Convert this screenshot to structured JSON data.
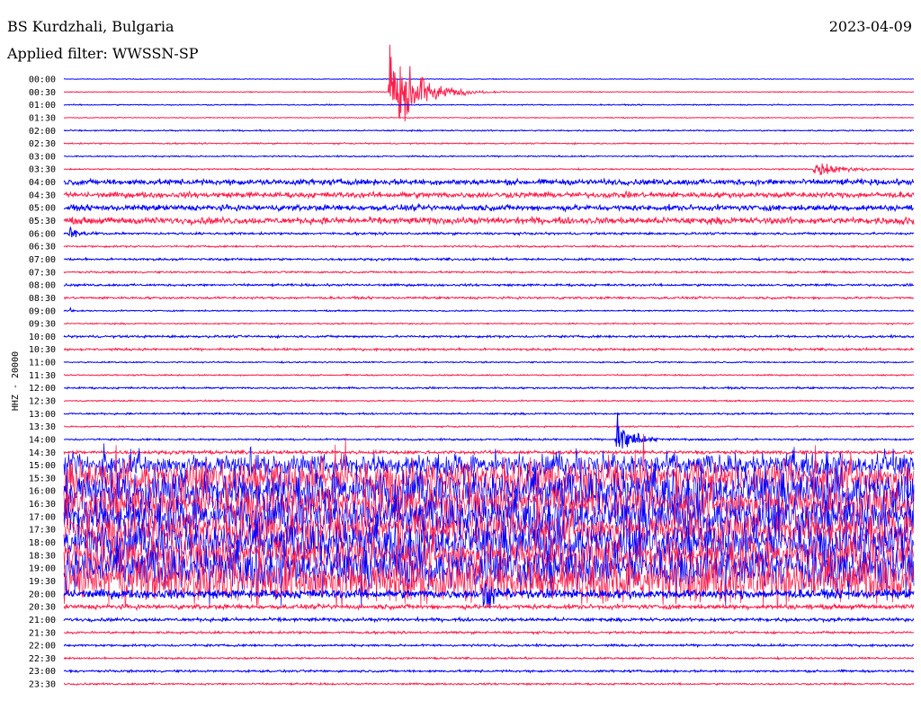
{
  "header": {
    "station": "BS Kurdzhali, Bulgaria",
    "date": "2023-04-09",
    "filter": "Applied filter: WWSSN-SP"
  },
  "chart_data": {
    "type": "line",
    "title": "BS Kurdzhali, Bulgaria",
    "ylabel": "HHZ - 20000",
    "colors": [
      "#0000ff",
      "#ff1e4b"
    ],
    "row_labels": [
      "00:00",
      "00:30",
      "01:00",
      "01:30",
      "02:00",
      "02:30",
      "03:00",
      "03:30",
      "04:00",
      "04:30",
      "05:00",
      "05:30",
      "06:00",
      "06:30",
      "07:00",
      "07:30",
      "08:00",
      "08:30",
      "09:00",
      "09:30",
      "10:00",
      "10:30",
      "11:00",
      "11:30",
      "12:00",
      "12:30",
      "13:00",
      "13:30",
      "14:00",
      "14:30",
      "15:00",
      "15:30",
      "16:00",
      "16:30",
      "17:00",
      "17:30",
      "18:00",
      "18:30",
      "19:00",
      "19:30",
      "20:00",
      "20:30",
      "21:00",
      "21:30",
      "22:00",
      "22:30",
      "23:00",
      "23:30"
    ],
    "minutes_per_row": 30,
    "noise_amplitude": [
      0.3,
      0.4,
      0.5,
      0.4,
      0.6,
      0.6,
      0.6,
      0.6,
      2.5,
      2.5,
      2.5,
      3.0,
      1.0,
      0.8,
      1.0,
      0.8,
      1.0,
      1.0,
      0.6,
      0.6,
      1.0,
      1.0,
      0.6,
      0.6,
      0.8,
      0.6,
      0.8,
      0.6,
      0.8,
      1.5,
      10,
      15,
      18,
      16,
      17,
      16,
      17,
      16,
      18,
      20,
      4,
      2,
      1.5,
      1.0,
      1.0,
      0.8,
      1.0,
      0.8
    ],
    "events": [
      {
        "row": 1,
        "minute": 11.5,
        "amplitude": 48,
        "duration_min": 2.5
      },
      {
        "row": 7,
        "minute": 26.5,
        "amplitude": 8,
        "duration_min": 2.5
      },
      {
        "row": 11,
        "minute": 29.5,
        "amplitude": 8,
        "duration_min": 0.5
      },
      {
        "row": 12,
        "minute": 0.2,
        "amplitude": 6,
        "duration_min": 1.2
      },
      {
        "row": 18,
        "minute": 0.2,
        "amplitude": 5,
        "duration_min": 0.3
      },
      {
        "row": 28,
        "minute": 19.5,
        "amplitude": 22,
        "duration_min": 1.5
      },
      {
        "row": 40,
        "minute": 14.8,
        "amplitude": 22,
        "duration_min": 1.0
      }
    ]
  }
}
